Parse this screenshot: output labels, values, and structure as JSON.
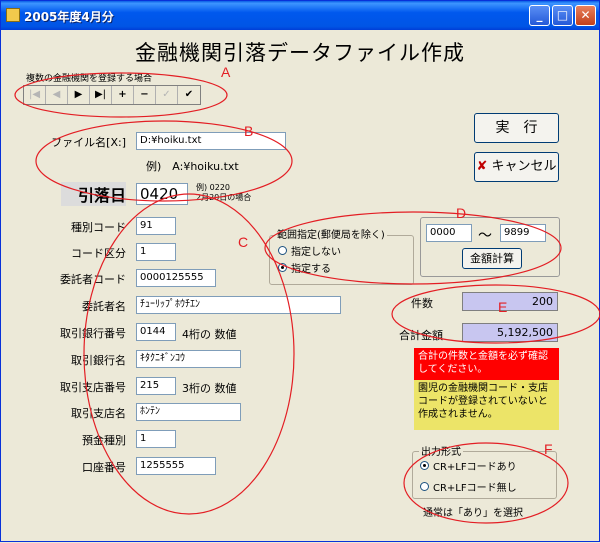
{
  "window": {
    "title": "2005年度4月分",
    "buttons": {
      "minimize": "_",
      "maximize": "□",
      "close": "✕"
    }
  },
  "main_title": "金融機関引落データファイル作成",
  "nav": {
    "caption": "複数の金融機関を登録する場合",
    "buttons": [
      "|◀",
      "◀",
      "▶",
      "▶|",
      "+",
      "−",
      "✓",
      "✔"
    ]
  },
  "file": {
    "label": "ファイル名[X:]",
    "value": "D:¥hoiku.txt",
    "example": "例)　A:¥hoiku.txt"
  },
  "withdraw_date": {
    "label": "引落日",
    "value": "0420",
    "note_line1": "例) 0220",
    "note_line2": "2月20日の場合"
  },
  "fields": [
    {
      "label": "種別コード",
      "value": "91",
      "note": ""
    },
    {
      "label": "コード区分",
      "value": "1",
      "note": ""
    },
    {
      "label": "委託者コード",
      "value": "0000125555",
      "note": ""
    },
    {
      "label": "委託者名",
      "value": "ﾁｭｰﾘｯﾌﾟﾎｳﾁｴﾝ",
      "note": ""
    },
    {
      "label": "取引銀行番号",
      "value": "0144",
      "note": "4桁の 数値"
    },
    {
      "label": "取引銀行名",
      "value": "ｷﾀｸﾆｷﾞﾝｺｳ",
      "note": ""
    },
    {
      "label": "取引支店番号",
      "value": "215",
      "note": "3桁の 数値"
    },
    {
      "label": "取引支店名",
      "value": "ﾎﾝﾃﾝ",
      "note": ""
    },
    {
      "label": "預金種別",
      "value": "1",
      "note": ""
    },
    {
      "label": "口座番号",
      "value": "1255555",
      "note": ""
    }
  ],
  "range": {
    "title": "範囲指定(郵便局を除く)",
    "options": [
      "指定しない",
      "指定する"
    ],
    "selected": 1,
    "from": "0000",
    "tilde": "～",
    "to": "9899",
    "calc_button": "金額計算"
  },
  "actions": {
    "execute": "実　行",
    "cancel": "キャンセル"
  },
  "summary": {
    "count_label": "件数",
    "count": "200",
    "total_label": "合計金額",
    "total": "5,192,500"
  },
  "warnings": {
    "red": "合計の件数と金額を必ず確認してください。",
    "yellow": "園児の金融機関コード・支店コードが登録されていないと作成されません。"
  },
  "output_format": {
    "title": "出力形式",
    "options": [
      "CR+LFコードあり",
      "CR+LFコード無し"
    ],
    "selected": 0,
    "note": "通常は「あり」を選択"
  },
  "annotation_markers": [
    "A",
    "B",
    "C",
    "D",
    "E",
    "F"
  ],
  "colors": {
    "titlebar": "#0058ee",
    "annotation": "#e31e24",
    "summary_bg": "#c8c6f0",
    "warning_red": "#ff0000",
    "warning_yellow": "#ece468"
  }
}
